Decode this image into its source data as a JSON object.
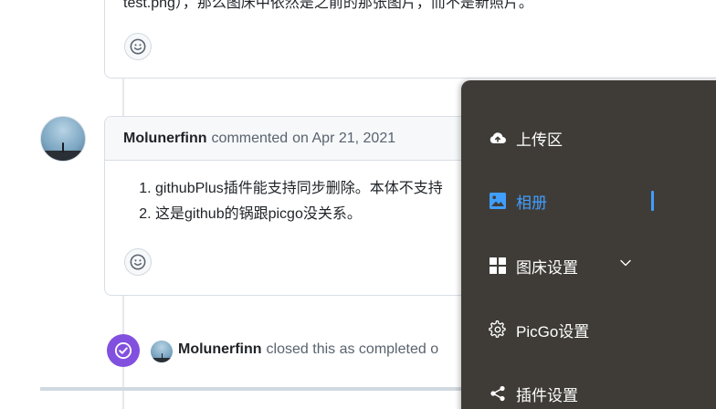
{
  "top_comment": {
    "text": "test.png），那么图床中依然是之前的那张图片，而不是新照片。"
  },
  "comment": {
    "author": "Molunerfinn",
    "action": "commented",
    "date": "on Apr 21, 2021",
    "list_items": [
      "githubPlus插件能支持同步删除。本体不支持",
      "这是github的锅跟picgo没关系。"
    ]
  },
  "event": {
    "author": "Molunerfinn",
    "text": "closed this as completed o"
  },
  "side_menu": {
    "items": [
      {
        "label": "上传区",
        "icon": "cloud-upload-icon"
      },
      {
        "label": "相册",
        "icon": "image-icon",
        "active": true
      },
      {
        "label": "图床设置",
        "icon": "grid-icon",
        "has_chevron": true
      },
      {
        "label": "PicGo设置",
        "icon": "gear-icon"
      },
      {
        "label": "插件设置",
        "icon": "share-icon"
      }
    ],
    "colors": {
      "background": "#3f3c37",
      "active": "#409eff",
      "text": "#ffffff"
    }
  },
  "colors": {
    "closed_badge": "#8250df",
    "border": "#d8dee4",
    "muted_text": "#59636e",
    "text": "#1f2328"
  }
}
